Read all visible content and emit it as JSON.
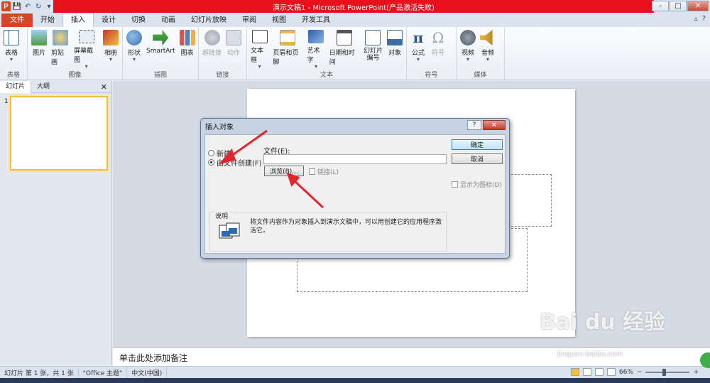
{
  "window": {
    "title": "演示文稿1 - Microsoft PowerPoint(产品激活失败)",
    "min": "–",
    "max": "□",
    "close": "✕",
    "logo": "P"
  },
  "qat": {
    "save": "💾",
    "undo": "↶",
    "redo": "↻",
    "more": "▾"
  },
  "tabs": [
    "文件",
    "开始",
    "插入",
    "设计",
    "切换",
    "动画",
    "幻灯片放映",
    "审阅",
    "视图",
    "开发工具"
  ],
  "tab_right": {
    "collapse": "▵",
    "help": "?"
  },
  "ribbon": {
    "groups": [
      {
        "label": "表格",
        "buttons": [
          {
            "label": "表格",
            "icon": "table-icon",
            "sub": "▾"
          }
        ]
      },
      {
        "label": "图像",
        "buttons": [
          {
            "label": "图片",
            "icon": "picture-icon"
          },
          {
            "label": "剪贴画",
            "icon": "clipart-icon"
          },
          {
            "label": "屏幕截图",
            "icon": "screenshot-icon",
            "sub": "▾"
          },
          {
            "label": "相册",
            "icon": "album-icon",
            "sub": "▾"
          }
        ]
      },
      {
        "label": "插图",
        "buttons": [
          {
            "label": "形状",
            "icon": "shapes-icon",
            "sub": "▾"
          },
          {
            "label": "SmartArt",
            "icon": "smartart-icon"
          },
          {
            "label": "图表",
            "icon": "chart-icon"
          }
        ]
      },
      {
        "label": "链接",
        "buttons": [
          {
            "label": "超链接",
            "icon": "hyperlink-icon",
            "dim": true
          },
          {
            "label": "动作",
            "icon": "action-icon",
            "dim": true
          }
        ]
      },
      {
        "label": "文本",
        "buttons": [
          {
            "label": "文本框",
            "icon": "textbox-icon",
            "sub": "▾"
          },
          {
            "label": "页眉和页脚",
            "icon": "header-footer-icon"
          },
          {
            "label": "艺术字",
            "icon": "wordart-icon",
            "sub": "▾"
          },
          {
            "label": "日期和时间",
            "icon": "datetime-icon"
          },
          {
            "label": "幻灯片\n编号",
            "icon": "slidenumber-icon"
          },
          {
            "label": "对象",
            "icon": "object-icon"
          }
        ]
      },
      {
        "label": "符号",
        "buttons": [
          {
            "label": "公式",
            "icon": "equation-icon",
            "sub": "▾"
          },
          {
            "label": "符号",
            "icon": "symbol-icon",
            "dim": true
          }
        ]
      },
      {
        "label": "媒体",
        "buttons": [
          {
            "label": "视频",
            "icon": "video-icon",
            "sub": "▾"
          },
          {
            "label": "音频",
            "icon": "audio-icon",
            "sub": "▾"
          }
        ]
      }
    ]
  },
  "leftpane": {
    "tab_slides": "幻灯片",
    "tab_outline": "大纲",
    "close": "✕",
    "slide_num": "1"
  },
  "notes": {
    "placeholder": "单击此处添加备注"
  },
  "status": {
    "slide": "幻灯片 第 1 张，共 1 张",
    "theme": "\"Office 主题\"",
    "lang": "中文(中国)",
    "zoom": "66%",
    "minus": "−",
    "plus": "+"
  },
  "dialog": {
    "title": "插入对象",
    "help": "?",
    "close": "✕",
    "opt_new": "新建",
    "opt_file": "由文件创建(F)",
    "file_label": "文件(E):",
    "file_value": "",
    "browse": "浏览(B)...",
    "link": "链接(L)",
    "ok": "确定",
    "cancel": "取消",
    "display_icon": "显示为图标(D)",
    "desc_title": "说明",
    "desc_text": "将文件内容作为对象插入到演示文稿中，可以用创建它的应用程序激活它。"
  },
  "watermark": {
    "logo": "Bai du 经验",
    "url": "jingyan.baidu.com"
  },
  "colors": {
    "title_bar_highlight": "#e8101a",
    "file_tab": "#d24726",
    "selection": "#f3c03e",
    "arrow": "#e3262d"
  }
}
